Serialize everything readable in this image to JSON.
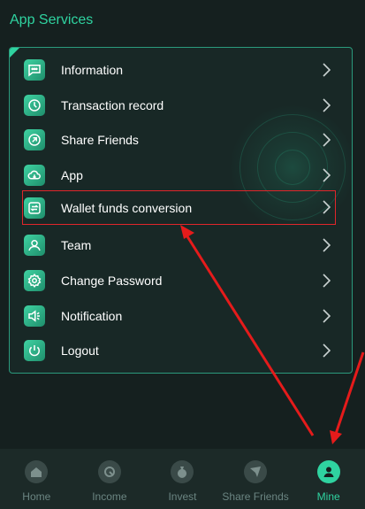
{
  "section": {
    "title": "App Services"
  },
  "menu": {
    "items": [
      {
        "label": "Information",
        "icon": "chat-bubble-icon"
      },
      {
        "label": "Transaction record",
        "icon": "clock-icon"
      },
      {
        "label": "Share Friends",
        "icon": "share-link-icon"
      },
      {
        "label": "App",
        "icon": "cloud-download-icon"
      },
      {
        "label": "Wallet funds conversion",
        "icon": "exchange-icon",
        "highlighted": true
      },
      {
        "label": "Team",
        "icon": "user-icon"
      },
      {
        "label": "Change Password",
        "icon": "gear-icon"
      },
      {
        "label": "Notification",
        "icon": "speaker-icon"
      },
      {
        "label": "Logout",
        "icon": "power-icon"
      }
    ]
  },
  "bottom_nav": {
    "items": [
      {
        "label": "Home",
        "icon": "house-icon"
      },
      {
        "label": "Income",
        "icon": "income-icon"
      },
      {
        "label": "Invest",
        "icon": "money-bag-icon"
      },
      {
        "label": "Share Friends",
        "icon": "paper-plane-icon"
      },
      {
        "label": "Mine",
        "icon": "user-icon",
        "active": true
      }
    ]
  },
  "colors": {
    "accent": "#2fd3a0",
    "background": "#15201f",
    "highlight_box": "#e0262b",
    "annotation_arrow": "#e51b1b"
  }
}
